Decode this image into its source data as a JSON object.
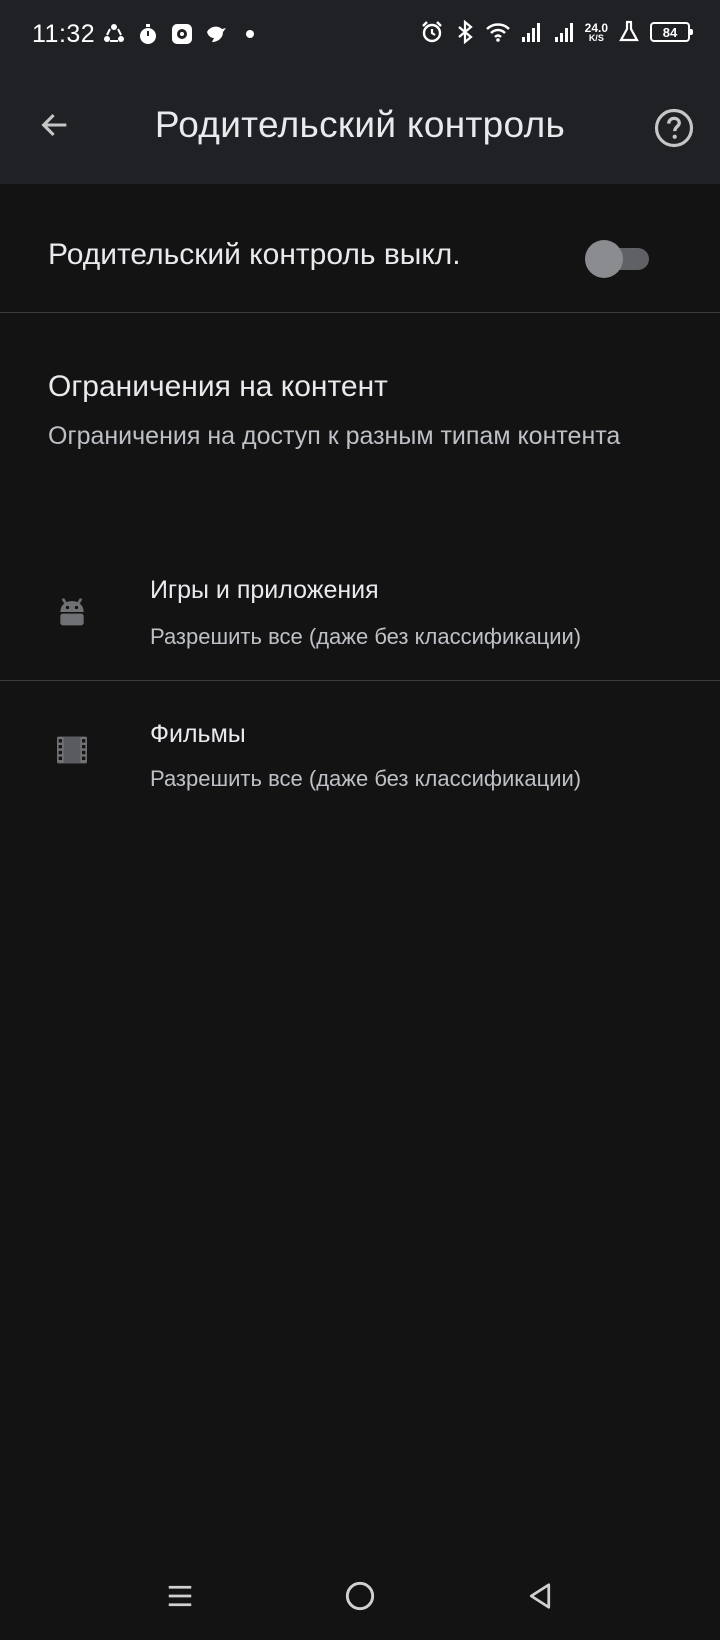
{
  "status_bar": {
    "time": "11:32",
    "net_speed_value": "24.0",
    "net_speed_unit": "K/S",
    "battery_level": "84",
    "left_icons": [
      "sync-icon",
      "timer-icon",
      "app-icon",
      "bird-icon",
      "dot-icon"
    ],
    "right_icons": [
      "alarm-icon",
      "bluetooth-icon",
      "wifi-icon",
      "signal-icon",
      "signal-icon",
      "lab-icon"
    ]
  },
  "app_bar": {
    "title": "Родительский контроль",
    "back_icon": "arrow-back-icon",
    "help_icon": "help-circle-icon"
  },
  "parental_toggle": {
    "label": "Родительский контроль выкл.",
    "state": "off"
  },
  "content_section": {
    "title": "Ограничения на контент",
    "description": "Ограничения на доступ к разным типам контента"
  },
  "items": [
    {
      "title": "Игры и приложения",
      "subtitle": "Разрешить все (даже без классификации)",
      "icon": "android-icon"
    },
    {
      "title": "Фильмы",
      "subtitle": "Разрешить все (даже без классификации)",
      "icon": "film-icon"
    }
  ],
  "nav_bar": {
    "buttons": [
      "recents-icon",
      "home-icon",
      "back-icon"
    ]
  },
  "colors": {
    "background": "#131314",
    "header": "#202124",
    "text_primary": "#e8eaed",
    "text_secondary": "#bdc1c6",
    "divider": "#3c3d40"
  }
}
